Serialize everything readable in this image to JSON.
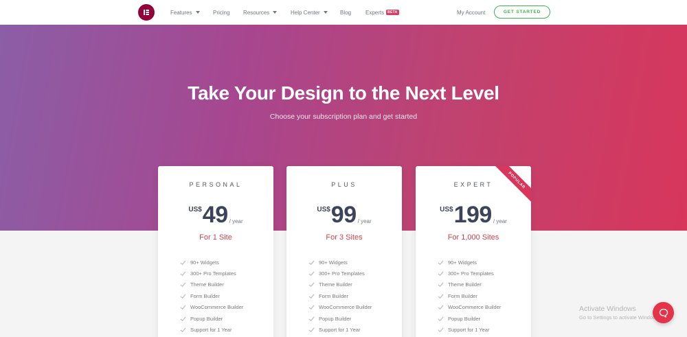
{
  "nav": {
    "items": [
      {
        "label": "Features",
        "has_dropdown": true
      },
      {
        "label": "Pricing",
        "has_dropdown": false
      },
      {
        "label": "Resources",
        "has_dropdown": true
      },
      {
        "label": "Help Center",
        "has_dropdown": true
      },
      {
        "label": "Blog",
        "has_dropdown": false
      },
      {
        "label": "Experts",
        "has_dropdown": false
      }
    ],
    "experts_badge": "BETA",
    "my_account": "My Account",
    "get_started": "GET STARTED"
  },
  "hero": {
    "title": "Take Your Design to the Next Level",
    "subtitle": "Choose your subscription plan and get started"
  },
  "plans": [
    {
      "name": "PERSONAL",
      "currency": "US$",
      "price": "49",
      "period": "/ year",
      "sites": "For 1 Site",
      "features": [
        "90+ Widgets",
        "300+ Pro Templates",
        "Theme Builder",
        "Form Builder",
        "WooCommerce Builder",
        "Popup Builder",
        "Support for 1 Year"
      ]
    },
    {
      "name": "PLUS",
      "currency": "US$",
      "price": "99",
      "period": "/ year",
      "sites": "For 3 Sites",
      "features": [
        "90+ Widgets",
        "300+ Pro Templates",
        "Theme Builder",
        "Form Builder",
        "WooCommerce Builder",
        "Popup Builder",
        "Support for 1 Year"
      ]
    },
    {
      "name": "EXPERT",
      "currency": "US$",
      "price": "199",
      "period": "/ year",
      "sites": "For 1,000 Sites",
      "ribbon": "POPULAR",
      "features": [
        "90+ Widgets",
        "300+ Pro Templates",
        "Theme Builder",
        "Form Builder",
        "WooCommerce Builder",
        "Popup Builder",
        "Support for 1 Year"
      ]
    }
  ],
  "watermark": {
    "title": "Activate Windows",
    "subtitle": "Go to Settings to activate Windows."
  },
  "colors": {
    "brand": "#92003b",
    "accent_green": "#39b54a",
    "sites_red": "#d63e4b",
    "chat": "#e3344a"
  },
  "icons": {
    "logo": "elementor-logo-icon",
    "check": "check-icon",
    "caret": "chevron-down-icon",
    "chat": "chat-bubble-icon"
  }
}
